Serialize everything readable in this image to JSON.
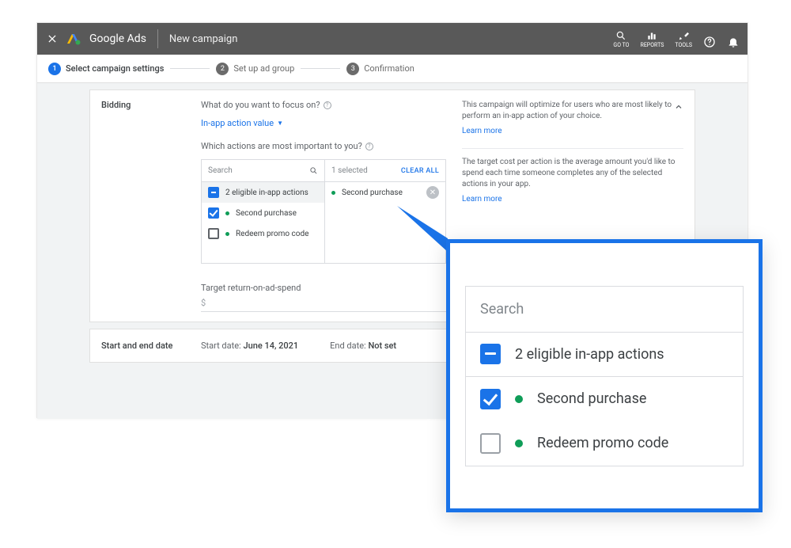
{
  "header": {
    "brand": "Google Ads",
    "subtitle": "New campaign",
    "icons": {
      "goto": "GO TO",
      "reports": "REPORTS",
      "tools": "TOOLS"
    }
  },
  "stepper": {
    "step1": "Select campaign settings",
    "step2": "Set up ad group",
    "step3": "Confirmation"
  },
  "bidding": {
    "title": "Bidding",
    "focus_question": "What do you want to focus on?",
    "focus_value": "In-app action value",
    "actions_question": "Which actions are most important to you?",
    "search_placeholder": "Search",
    "selected_count": "1 selected",
    "clear_all": "CLEAR ALL",
    "eligible_header": "2 eligible in-app actions",
    "action1": "Second purchase",
    "action2": "Redeem promo code",
    "selected_item": "Second purchase",
    "target_label": "Target return-on-ad-spend",
    "target_prefix": "$"
  },
  "info": {
    "block1": "This campaign will optimize for users who are most likely to perform an in-app action of your choice.",
    "learn1": "Learn more",
    "block2": "The target cost per action is the average amount you'd like to spend each time someone completes any of the selected actions in your app.",
    "learn2": "Learn more"
  },
  "dates": {
    "section": "Start and end date",
    "start_label": "Start date:",
    "start_value": "June 14, 2021",
    "end_label": "End date:",
    "end_value": "Not set"
  },
  "callout": {
    "search": "Search",
    "header": "2 eligible in-app actions",
    "row1": "Second purchase",
    "row2": "Redeem promo code"
  }
}
